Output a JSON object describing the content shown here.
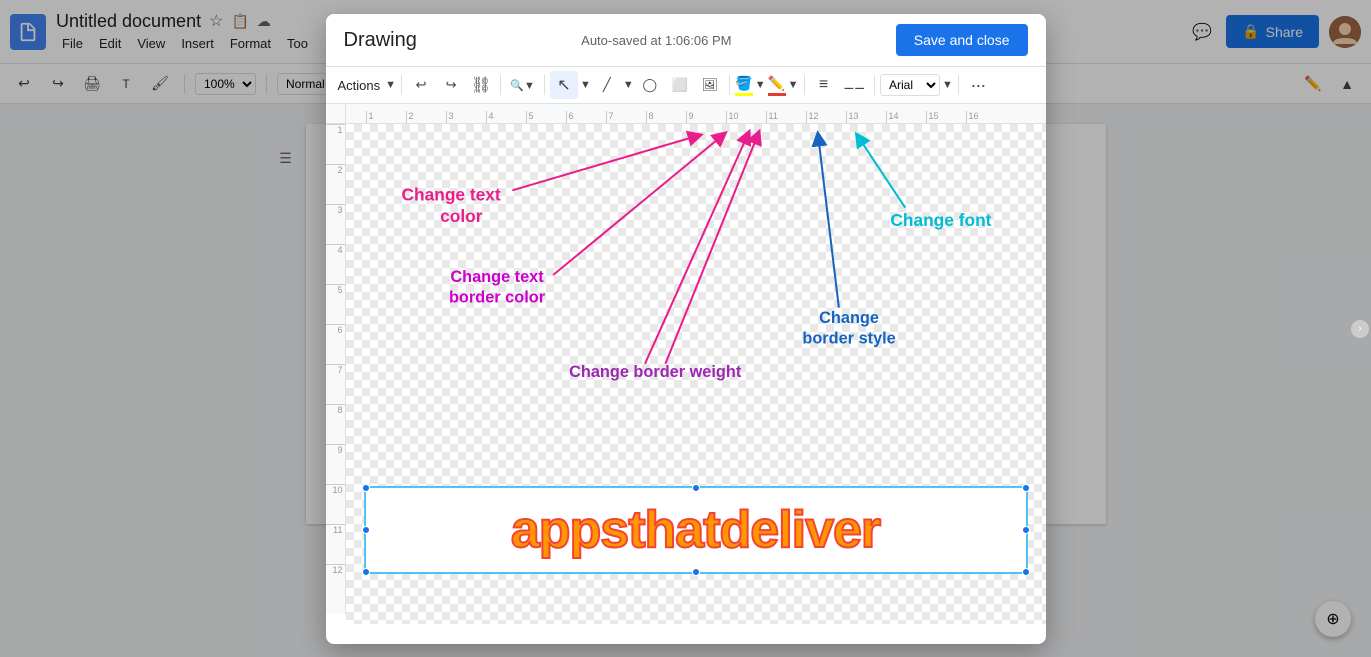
{
  "docs": {
    "title": "Untitled document",
    "menu": [
      "File",
      "Edit",
      "View",
      "Insert",
      "Format",
      "Too"
    ],
    "zoom": "100%",
    "style": "Normal text",
    "share_label": "Share",
    "toolbar": {
      "undo": "↩",
      "redo": "↪",
      "print": "🖨",
      "spell": "T",
      "paint": "🖌",
      "zoom_label": "100%",
      "style_label": "Normal text"
    }
  },
  "drawing": {
    "title": "Drawing",
    "autosave": "Auto-saved at 1:06:06 PM",
    "save_close_label": "Save and close",
    "toolbar": {
      "actions_label": "Actions",
      "font_label": "Arial",
      "more_label": "···"
    },
    "annotations": {
      "change_text_color": "Change text\ncolor",
      "change_text_border": "Change text\nborder color",
      "change_border_weight": "Change border weight",
      "change_border_style": "Change\nborder style",
      "change_font": "Change font"
    },
    "textbox": {
      "content": "appsthatdeliver"
    }
  }
}
